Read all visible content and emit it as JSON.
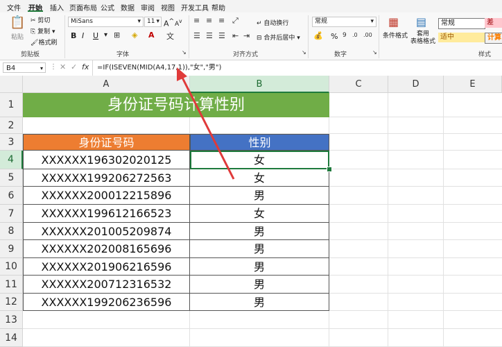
{
  "menu": {
    "items": [
      "文件",
      "开始",
      "插入",
      "页面布局",
      "公式",
      "数据",
      "审阅",
      "视图",
      "开发工具",
      "帮助"
    ],
    "active_index": 1
  },
  "ribbon": {
    "clipboard": {
      "paste": "粘贴",
      "cut": "剪切",
      "copy": "复制",
      "format_painter": "格式刷",
      "label": "剪贴板"
    },
    "font": {
      "name": "MiSans",
      "size": "11",
      "bold": "B",
      "italic": "I",
      "underline": "U",
      "grow": "A",
      "shrink": "A",
      "label": "字体"
    },
    "alignment": {
      "wrap": "自动换行",
      "merge": "合并后居中",
      "label": "对齐方式"
    },
    "number": {
      "format": "常规",
      "percent": "%",
      "label": "数字"
    },
    "styles": {
      "conditional": "条件格式",
      "table_format": "套用\n表格格式",
      "normal": "常规",
      "bad": "差",
      "neutral": "适中",
      "calc": "计算",
      "label": "样式"
    }
  },
  "formula_bar": {
    "name_box": "B4",
    "fx": "fx",
    "formula": "=IF(ISEVEN(MID(A4,17,1)),\"女\",\"男\")"
  },
  "columns": [
    "A",
    "B",
    "C",
    "D",
    "E"
  ],
  "rows": [
    "1",
    "2",
    "3",
    "4",
    "5",
    "6",
    "7",
    "8",
    "9",
    "10",
    "11",
    "12",
    "13",
    "14"
  ],
  "sheet": {
    "title": "身份证号码计算性别",
    "header_a": "身份证号码",
    "header_b": "性别",
    "records": [
      {
        "id": "XXXXXX196302020125",
        "gender": "女"
      },
      {
        "id": "XXXXXX199206272563",
        "gender": "女"
      },
      {
        "id": "XXXXXX200012215896",
        "gender": "男"
      },
      {
        "id": "XXXXXX199612166523",
        "gender": "女"
      },
      {
        "id": "XXXXXX201005209874",
        "gender": "男"
      },
      {
        "id": "XXXXXX202008165696",
        "gender": "男"
      },
      {
        "id": "XXXXXX201906216596",
        "gender": "男"
      },
      {
        "id": "XXXXXX200712316532",
        "gender": "男"
      },
      {
        "id": "XXXXXX199206236596",
        "gender": "男"
      }
    ]
  },
  "colors": {
    "title_bg": "#70ad47",
    "header_a_bg": "#ed7d31",
    "header_b_bg": "#4472c4",
    "selection": "#1e7a3c",
    "arrow": "#e03a3a"
  }
}
